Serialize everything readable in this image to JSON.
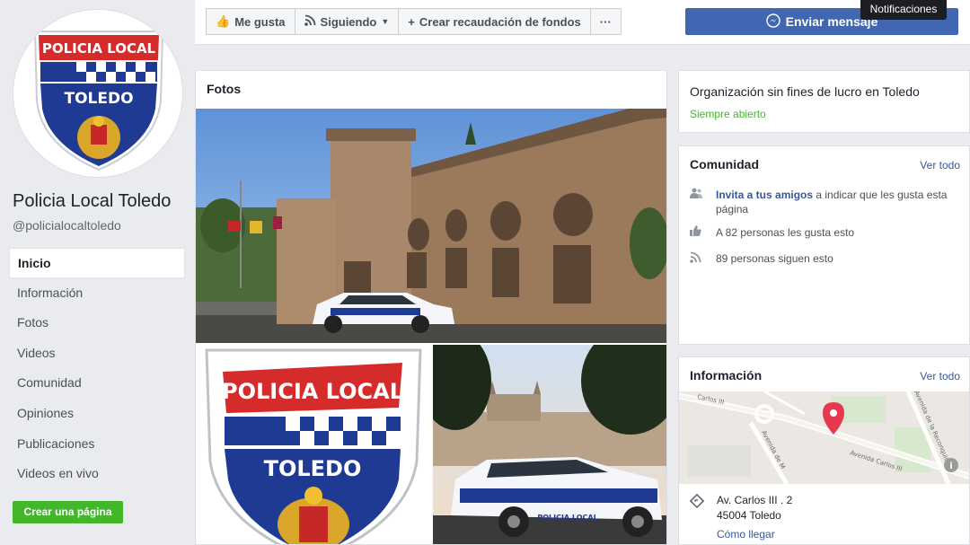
{
  "page": {
    "name": "Policia Local Toledo",
    "handle": "@policialocaltoledo",
    "logo_text": "POLICIA LOCAL",
    "logo_city": "TOLEDO"
  },
  "nav": {
    "items": [
      {
        "label": "Inicio",
        "active": true
      },
      {
        "label": "Información"
      },
      {
        "label": "Fotos"
      },
      {
        "label": "Videos"
      },
      {
        "label": "Comunidad"
      },
      {
        "label": "Opiniones"
      },
      {
        "label": "Publicaciones"
      },
      {
        "label": "Videos en vivo"
      }
    ],
    "create_page": "Crear una página"
  },
  "actions": {
    "like": "Me gusta",
    "like_icon": "thumbs-up-icon",
    "follow": "Siguiendo",
    "follow_icon": "rss-icon",
    "fundraiser": "Crear recaudación de fondos",
    "more": "···",
    "send_message": "Enviar mensaje",
    "notifications_tooltip": "Notificaciones"
  },
  "photos": {
    "title": "Fotos",
    "car_label": "POLICIA LOCAL"
  },
  "about": {
    "category": "Organización sin fines de lucro en Toledo",
    "hours": "Siempre abierto"
  },
  "community": {
    "title": "Comunidad",
    "see_all": "Ver todo",
    "invite_link": "Invita a tus amigos",
    "invite_rest": " a indicar que les gusta esta página",
    "likes": "A 82 personas les gusta esto",
    "follows": "89 personas siguen esto"
  },
  "info": {
    "title": "Información",
    "see_all": "Ver todo",
    "address_line1": "Av. Carlos III . 2",
    "address_line2": "45004 Toledo",
    "directions": "Cómo llegar",
    "map_labels": {
      "street1": "Carlos III",
      "street2": "Avenida de la Reconquista",
      "street3": "Avenida Carlos III",
      "street4": "Avenida de M"
    }
  },
  "colors": {
    "brand_blue": "#4267b2",
    "green": "#42b72a",
    "link": "#365899",
    "police_red": "#d62b2b",
    "police_navy": "#1f3a93"
  }
}
